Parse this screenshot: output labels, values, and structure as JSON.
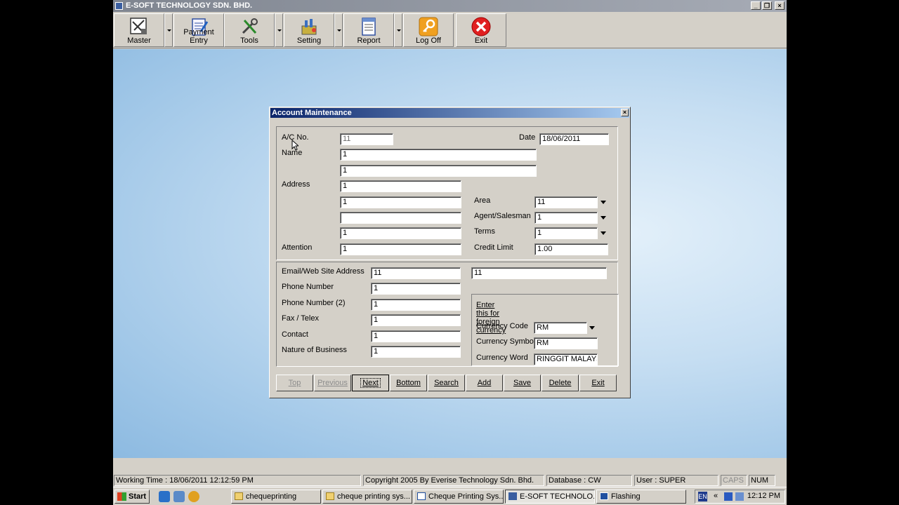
{
  "window": {
    "title": "E-SOFT TECHNOLOGY SDN. BHD."
  },
  "toolbar": {
    "items": [
      {
        "label": "Master",
        "icon": "master-icon"
      },
      {
        "label": "Payment Entry",
        "icon": "payment-entry-icon"
      },
      {
        "label": "Tools",
        "icon": "tools-icon"
      },
      {
        "label": "Setting",
        "icon": "setting-icon"
      },
      {
        "label": "Report",
        "icon": "report-icon"
      },
      {
        "label": "Log Off",
        "icon": "key-icon"
      },
      {
        "label": "Exit",
        "icon": "exit-icon"
      }
    ]
  },
  "dialog": {
    "title": "Account Maintenance",
    "labels": {
      "ac_no": "A/C No.",
      "date": "Date",
      "name": "Name",
      "address": "Address",
      "attention": "Attention",
      "area": "Area",
      "agent": "Agent/Salesman",
      "terms": "Terms",
      "credit_limit": "Credit Limit",
      "email": "Email/Web Site Address",
      "phone": "Phone Number",
      "phone2": "Phone Number (2)",
      "fax": "Fax / Telex",
      "contact": "Contact",
      "nature": "Nature of Business",
      "foreign_note": "Enter this for foreign currency",
      "currency_code": "Currency Code",
      "currency_symbol": "Currency Symbol",
      "currency_word": "Currency Word"
    },
    "values": {
      "ac_no": "11",
      "date": "18/06/2011",
      "name1": "1",
      "name2": "1",
      "address1": "1",
      "address2": "1",
      "address3": "",
      "address4": "1",
      "attention": "1",
      "area": "11",
      "agent": "1",
      "terms": "1",
      "credit_limit": "1.00",
      "email": "11",
      "website": "11",
      "phone": "1",
      "phone2": "1",
      "fax": "1",
      "contact": "1",
      "nature": "1",
      "currency_code": "RM",
      "currency_symbol": "RM",
      "currency_word": "RINGGIT MALAYS"
    },
    "buttons": {
      "top": "Top",
      "previous": "Previous",
      "next": "Next",
      "bottom": "Bottom",
      "search": "Search",
      "add": "Add",
      "save": "Save",
      "delete": "Delete",
      "exit": "Exit"
    }
  },
  "statusbar": {
    "working_time": "Working Time : 18/06/2011  12:12:59 PM",
    "copyright": "Copyright 2005 By Everise Technology Sdn. Bhd.",
    "database": "Database : CW",
    "user": "User : SUPER",
    "caps": "CAPS",
    "num": "NUM"
  },
  "taskbar": {
    "start": "Start",
    "tasks": [
      {
        "label": "chequeprinting",
        "icon": "folder-icon"
      },
      {
        "label": "cheque printing sys...",
        "icon": "folder-icon"
      },
      {
        "label": "Cheque Printing Sys...",
        "icon": "document-icon"
      },
      {
        "label": "E-SOFT TECHNOLO...",
        "icon": "app-icon"
      },
      {
        "label": "Flashing",
        "icon": "window-icon"
      }
    ],
    "lang": "EN",
    "clock": "12:12 PM"
  },
  "colors": {
    "dialog_title": "#0a246a",
    "exit_icon": "#e02020",
    "log_off_icon": "#e8a020"
  }
}
